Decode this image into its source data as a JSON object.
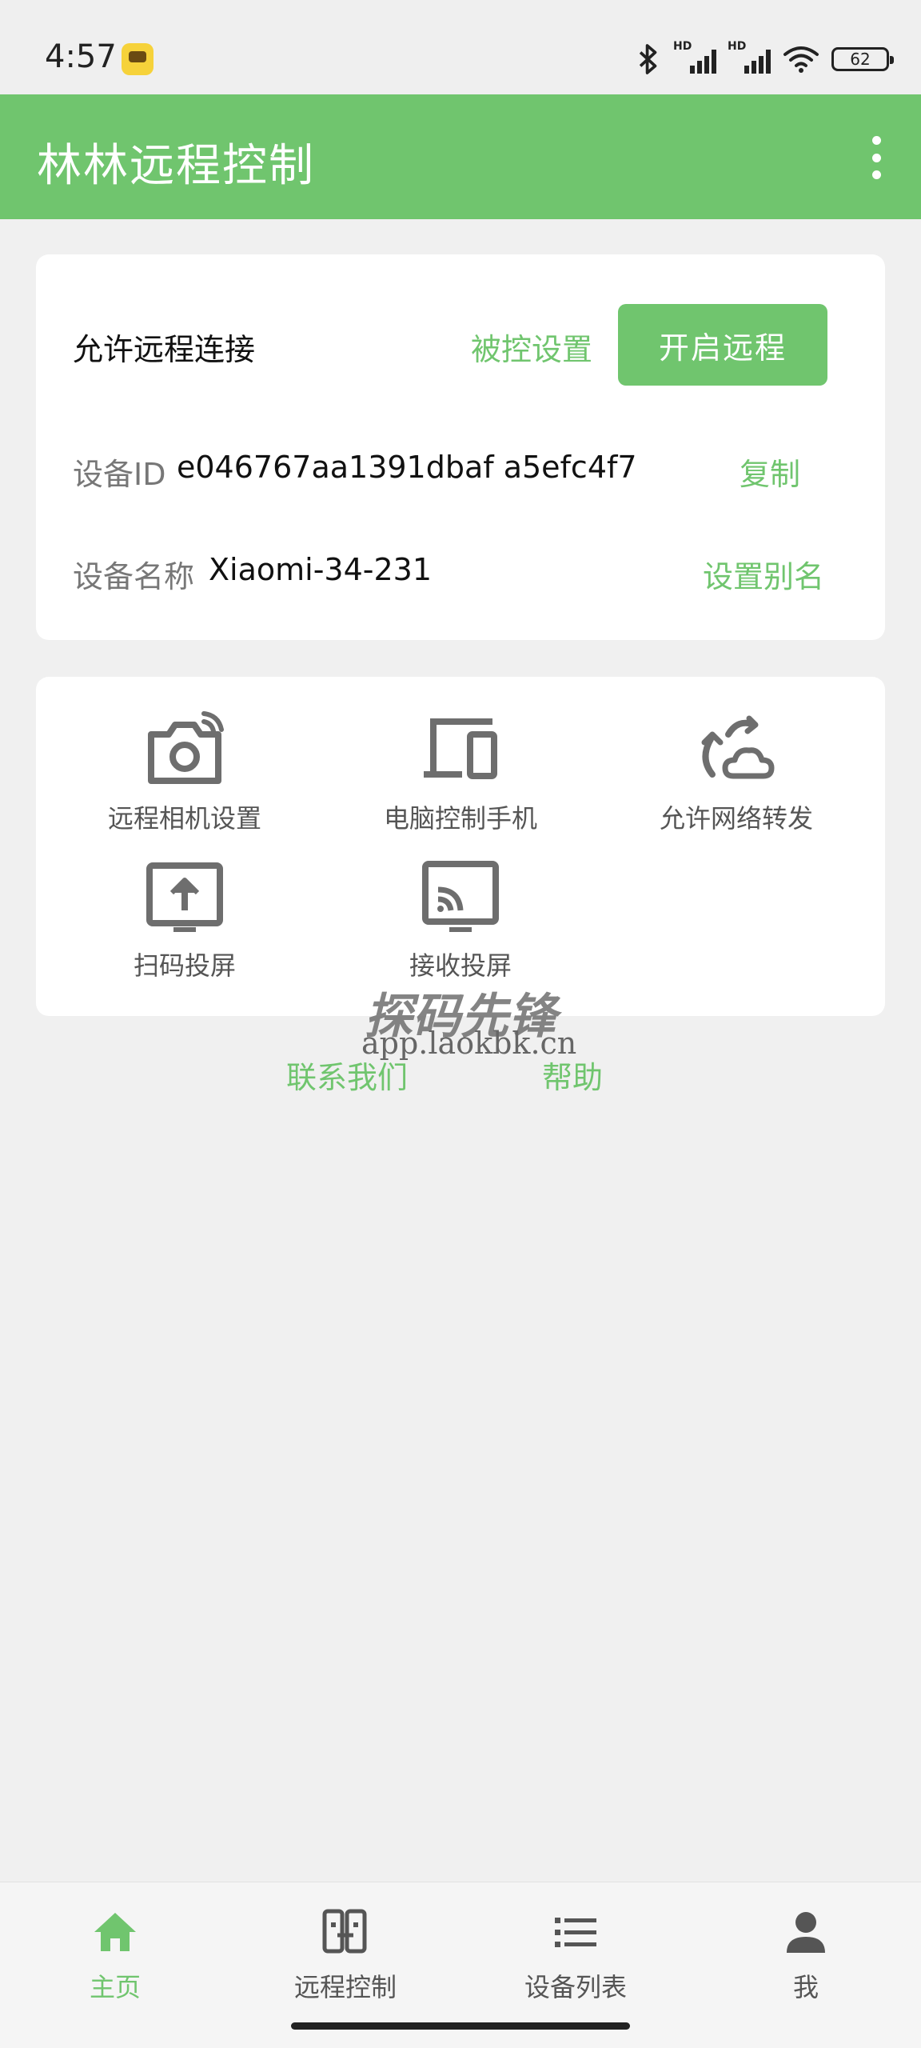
{
  "status_bar": {
    "time": "4:57",
    "signal_label_1": "HD",
    "signal_label_2": "HD",
    "battery": "62",
    "icons": [
      "app-notification-icon",
      "bluetooth-icon",
      "signal-icon",
      "signal-icon",
      "wifi-icon",
      "battery-icon"
    ]
  },
  "app_bar": {
    "title": "林林远程控制",
    "menu_icon": "more-vert-icon"
  },
  "remote_card": {
    "allow_label": "允许远程连接",
    "controlled_settings": "被控设置",
    "start_button": "开启远程",
    "device_id_label": "设备ID",
    "device_id_value": "e046767aa1391dbaf   a5efc4f7",
    "copy_button": "复制",
    "device_name_label": "设备名称",
    "device_name_value": "Xiaomi-34-231",
    "alias_button": "设置别名"
  },
  "features": {
    "remote_camera": "远程相机设置",
    "pc_control_phone": "电脑控制手机",
    "network_forward": "允许网络转发",
    "scan_cast": "扫码投屏",
    "receive_cast": "接收投屏"
  },
  "links": {
    "contact": "联系我们",
    "help": "帮助"
  },
  "watermark": {
    "title": "探码先锋",
    "url": "app.laokbk.cn"
  },
  "bottom_nav": {
    "home": "主页",
    "remote_control": "远程控制",
    "device_list": "设备列表",
    "me": "我",
    "active": "主页",
    "active_color": "#70c56e"
  },
  "colors": {
    "accent": "#70c56e",
    "background": "#f0f0f0",
    "card": "#ffffff"
  }
}
